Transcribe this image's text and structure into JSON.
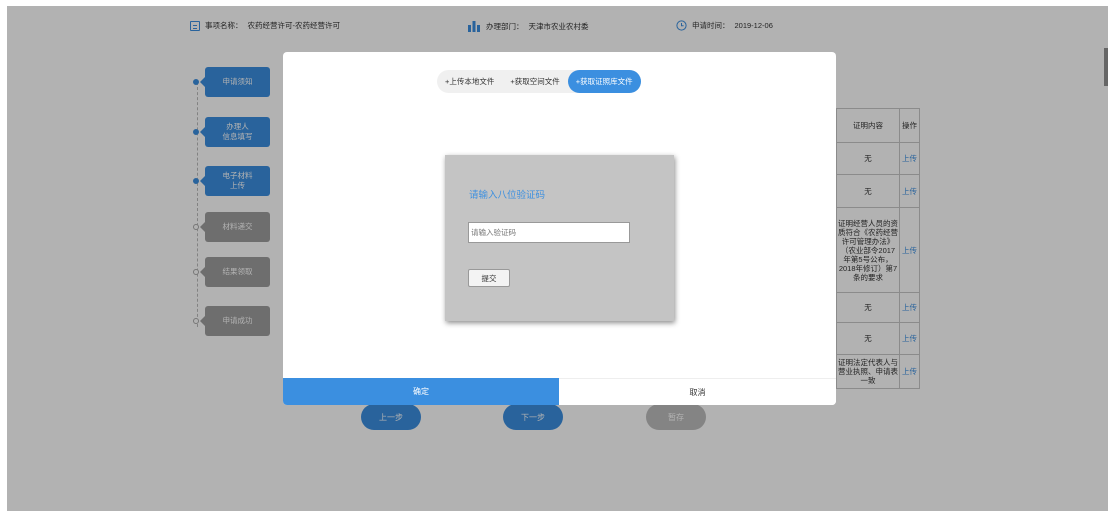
{
  "header": {
    "item_label": "事项名称：",
    "item_value": "农药经营许可-农药经营许可",
    "dept_label": "办理部门：",
    "dept_value": "天津市农业农村委",
    "date_label": "申请时间：",
    "date_value": "2019-12-06"
  },
  "steps": [
    {
      "label": "申请须知",
      "state": "active"
    },
    {
      "label": "办理人\n信息填写",
      "state": "active"
    },
    {
      "label": "电子材料\n上传",
      "state": "active"
    },
    {
      "label": "材料递交",
      "state": "inactive"
    },
    {
      "label": "结果领取",
      "state": "inactive"
    },
    {
      "label": "申请成功",
      "state": "inactive"
    }
  ],
  "table": {
    "headers": [
      "证明内容",
      "操作"
    ],
    "rows": [
      {
        "content": "无",
        "action": "上传"
      },
      {
        "content": "无",
        "action": "上传"
      },
      {
        "content": "证明经营人员的资质符合《农药经营许可管理办法》（农业部令2017年第5号公布，2018年修订）第7条的要求",
        "action": "上传"
      },
      {
        "content": "无",
        "action": "上传"
      },
      {
        "content": "无",
        "action": "上传"
      },
      {
        "content": "证明法定代表人与营业执照、申请表一致",
        "action": "上传"
      }
    ]
  },
  "nav": {
    "prev": "上一步",
    "next": "下一步",
    "save": "暂存"
  },
  "modal": {
    "tabs": [
      {
        "label": "+上传本地文件",
        "active": false
      },
      {
        "label": "+获取空间文件",
        "active": false
      },
      {
        "label": "+获取证照库文件",
        "active": true
      }
    ],
    "verify_title": "请输入八位验证码",
    "verify_placeholder": "请输入验证码",
    "submit_label": "提交",
    "confirm_label": "确定",
    "cancel_label": "取消"
  },
  "colors": {
    "accent": "#3b8fe0",
    "inactive": "#9e9e9e",
    "overlay": "rgba(0,0,0,0.3)"
  }
}
